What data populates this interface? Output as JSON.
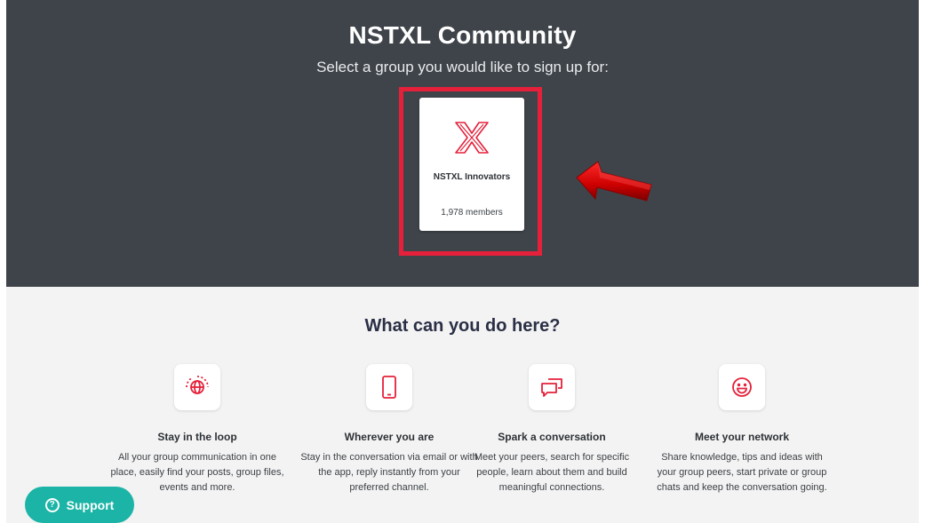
{
  "hero": {
    "title": "NSTXL Community",
    "subtitle": "Select a group you would like to sign up for:"
  },
  "group_card": {
    "logo_icon": "nstxl-x-logo",
    "name": "NSTXL Innovators",
    "members": "1,978 members"
  },
  "annotation": {
    "highlight_color": "#e5203a",
    "arrow_icon": "red-arrow-pointing-left"
  },
  "features": {
    "title": "What can you do here?",
    "items": [
      {
        "icon": "globe-icon",
        "title": "Stay in the loop",
        "description": "All your group communication in one place, easily find your posts, group files, events and more."
      },
      {
        "icon": "mobile-phone-icon",
        "title": "Wherever you are",
        "description": "Stay in the conversation via email or with the app, reply instantly from your preferred channel."
      },
      {
        "icon": "chat-bubbles-icon",
        "title": "Spark a conversation",
        "description": "Meet your peers, search for specific people, learn about them and build meaningful connections."
      },
      {
        "icon": "smiley-face-icon",
        "title": "Meet your network",
        "description": "Share knowledge, tips and ideas with your group peers, start private or group chats and keep the conversation going."
      }
    ]
  },
  "support": {
    "label": "Support",
    "icon": "question-circle-icon"
  },
  "colors": {
    "hero_bg": "#3f444a",
    "accent": "#e5203a",
    "support": "#1bb4a6",
    "section_bg": "#f3f3f3"
  }
}
